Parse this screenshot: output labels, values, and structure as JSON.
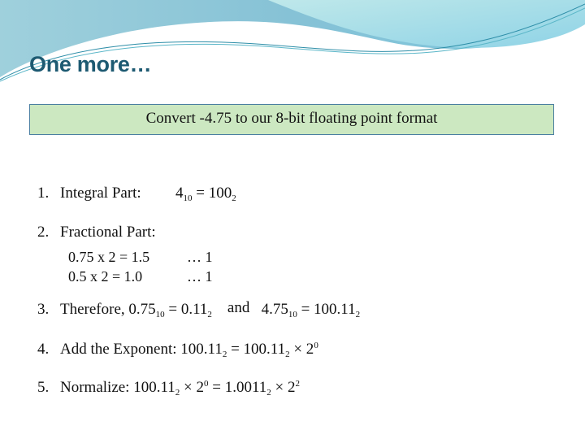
{
  "slide": {
    "title": "One more…",
    "banner": "Convert -4.75 to our 8-bit floating point format",
    "steps": [
      {
        "num": "1.",
        "label": "Integral Part:",
        "expr": {
          "a": "4",
          "a_sub": "10",
          "eq": " = ",
          "b": "100",
          "b_sub": "2"
        }
      },
      {
        "num": "2.",
        "label": "Fractional Part:"
      },
      {
        "num": "3.",
        "label": "Therefore,",
        "a": "0.75",
        "a_sub": "10",
        "eq1": " = 0.11",
        "b_sub": "2",
        "and": "and",
        "c": "4.75",
        "c_sub": "10",
        "eq2": " = 100.11",
        "d_sub": "2"
      },
      {
        "num": "4.",
        "label": "Add the Exponent:",
        "a": "100.11",
        "a_sub": "2",
        "eq": " = 100.11",
        "b_sub": "2",
        "times": " × 2",
        "exp": "0"
      },
      {
        "num": "5.",
        "label": "Normalize:",
        "a": "100.11",
        "a_sub": "2",
        "times1": " × 2",
        "exp1": "0",
        "eq": " = 1.0011",
        "b_sub": "2",
        "times2": " × 2",
        "exp2": "2"
      }
    ],
    "fraction_rows": [
      {
        "calc": "0.75 x 2  = 1.5",
        "bit": "… 1"
      },
      {
        "calc": "0.5 x 2 = 1.0",
        "bit": "… 1"
      }
    ]
  }
}
